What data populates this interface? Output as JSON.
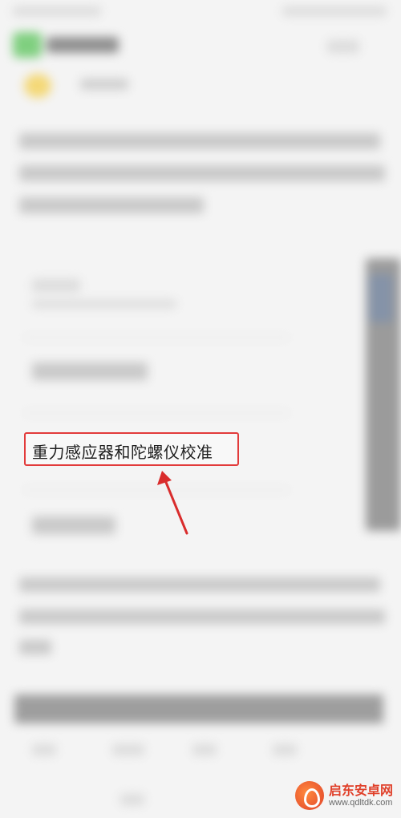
{
  "highlighted_setting": {
    "label": "重力感应器和陀螺仪校准"
  },
  "watermark": {
    "brand": "启东安卓网",
    "url": "www.qdltdk.com"
  },
  "colors": {
    "highlight_border": "#e23b3b",
    "arrow": "#d92c2c"
  },
  "icons": [
    "arrow-pointer-icon",
    "watermark-logo-icon"
  ]
}
